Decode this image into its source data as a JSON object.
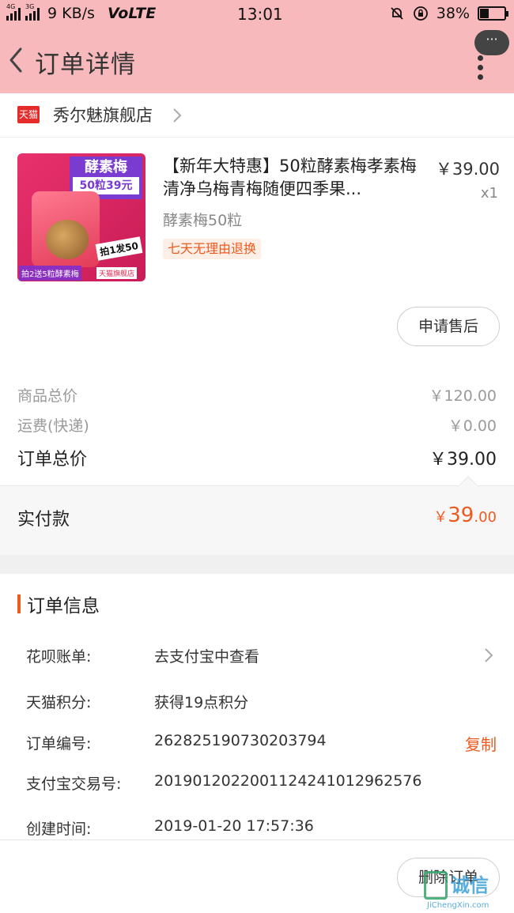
{
  "status_bar": {
    "network": "4G",
    "network2": "3G",
    "speed": "9 KB/s",
    "volte": "VoLTE",
    "time": "13:01",
    "battery": "38%",
    "battery_level": 0.38
  },
  "nav": {
    "title": "订单详情",
    "more_bubble": "···"
  },
  "shop": {
    "badge": "天猫",
    "name": "秀尔魅旗舰店"
  },
  "product": {
    "image_tag_top": "酵素梅",
    "image_tag_bottom": "50粒39元",
    "image_promo": "拍1发50",
    "image_gift": "拍2送5粒酵素梅",
    "image_store": "天猫旗舰店",
    "title": "【新年大特惠】50粒酵素梅孝素梅清净乌梅青梅随便四季果...",
    "sku": "酵素梅50粒",
    "tag": "七天无理由退换",
    "price": "￥39.00",
    "qty": "x1",
    "aftersale_button": "申请售后"
  },
  "summary": {
    "goods_total_label": "商品总价",
    "goods_total_value": "￥120.00",
    "shipping_label": "运费(快递)",
    "shipping_value": "￥0.00",
    "order_total_label": "订单总价",
    "order_total_value": "￥39.00",
    "paid_label": "实付款",
    "paid_currency": "￥",
    "paid_int": "39",
    "paid_dec": ".00"
  },
  "order_info": {
    "title": "订单信息",
    "rows": [
      {
        "label": "花呗账单:",
        "value": "去支付宝中查看"
      },
      {
        "label": "天猫积分:",
        "value": "获得19点积分"
      },
      {
        "label": "订单编号:",
        "value": "262825190730203794",
        "action": "复制"
      },
      {
        "label": "支付宝交易号:",
        "value": "2019012022001124241012962576"
      },
      {
        "label": "创建时间:",
        "value": "2019-01-20 17:57:36"
      }
    ]
  },
  "footer": {
    "delete_button": "删除订单"
  },
  "watermark": {
    "cn": "诚信",
    "en": "JiChengXin.com"
  },
  "colors": {
    "header_bg": "#f7b9bb",
    "accent": "#ec5a1f",
    "tmall_red": "#e52a2a"
  }
}
